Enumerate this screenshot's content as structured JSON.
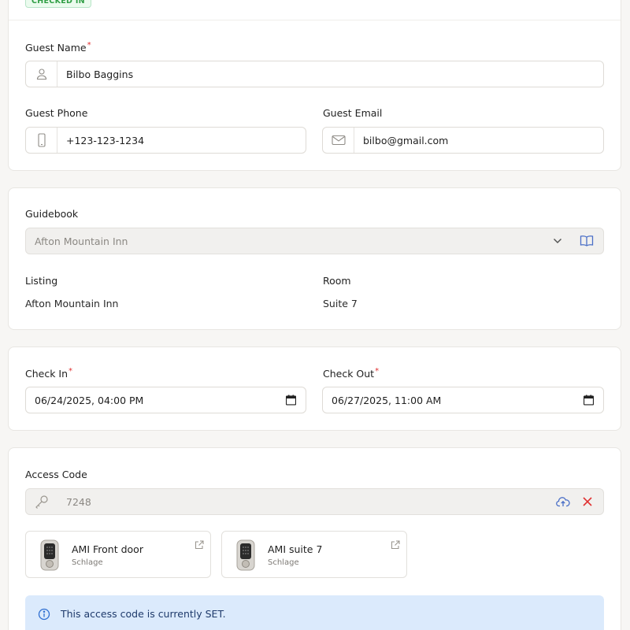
{
  "status": {
    "badge": "CHECKED IN",
    "color": "#2f9e44"
  },
  "guest": {
    "name_label": "Guest Name",
    "name_value": "Bilbo Baggins",
    "name_icon": "user-icon",
    "phone_label": "Guest Phone",
    "phone_value": "+123-123-1234",
    "phone_icon": "phone-icon",
    "email_label": "Guest Email",
    "email_value": "bilbo@gmail.com",
    "email_icon": "mail-icon"
  },
  "guidebook": {
    "label": "Guidebook",
    "value": "Afton Mountain Inn",
    "listing_label": "Listing",
    "listing_value": "Afton Mountain Inn",
    "room_label": "Room",
    "room_value": "Suite 7"
  },
  "dates": {
    "check_in_label": "Check In",
    "check_in_value": "06/24/2025, 04:00 PM",
    "check_out_label": "Check Out",
    "check_out_value": "06/27/2025, 11:00 AM"
  },
  "access": {
    "label": "Access Code",
    "code": "7248",
    "locks": [
      {
        "name": "AMI Front door",
        "brand": "Schlage"
      },
      {
        "name": "AMI suite 7",
        "brand": "Schlage"
      }
    ],
    "alert": "This access code is currently SET.",
    "accent": "#4a6fc7",
    "danger": "#e03131"
  }
}
